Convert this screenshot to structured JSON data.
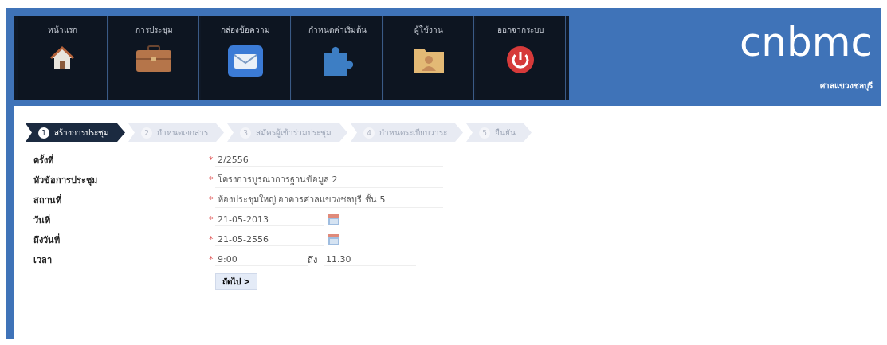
{
  "menu": [
    {
      "label": "หน้าแรก",
      "kind": "home"
    },
    {
      "label": "การประชุม",
      "kind": "briefcase"
    },
    {
      "label": "กล่องข้อความ",
      "kind": "mail"
    },
    {
      "label": "กำหนดค่าเริ่มต้น",
      "kind": "puzzle"
    },
    {
      "label": "ผู้ใช้งาน",
      "kind": "folder"
    },
    {
      "label": "ออกจากระบบ",
      "kind": "power"
    }
  ],
  "brand": {
    "logo": "cnbmc",
    "subtitle": "ศาลแขวงชลบุรี"
  },
  "steps": [
    {
      "number": "1",
      "label": "สร้างการประชุม",
      "selected": true
    },
    {
      "number": "2",
      "label": "กำหนดเอกสาร",
      "selected": false
    },
    {
      "number": "3",
      "label": "สมัครผู้เข้าร่วมประชุม",
      "selected": false
    },
    {
      "number": "4",
      "label": "กำหนดระเบียบวาระ",
      "selected": false
    },
    {
      "number": "5",
      "label": "ยืนยัน",
      "selected": false
    }
  ],
  "fields": [
    {
      "kind": "text",
      "label": "ครั้งที่",
      "mark": "*",
      "value": "2/2556"
    },
    {
      "kind": "text",
      "label": "หัวข้อการประชุม",
      "mark": "*",
      "value": "โครงการบูรณาการฐานข้อมูล 2"
    },
    {
      "kind": "text",
      "label": "สถานที่",
      "mark": "*",
      "value": "ห้องประชุมใหญ่  อาคารศาลแขวงชลบุรี ชั้น 5"
    },
    {
      "kind": "date",
      "label": "วันที่",
      "mark": "*",
      "value": "21-05-2013"
    },
    {
      "kind": "date",
      "label": "ถึงวันที่",
      "mark": "*",
      "value": "21-05-2556"
    },
    {
      "kind": "time",
      "label": "เวลา",
      "mark": "*",
      "value": "9:00",
      "to_label": "ถึง",
      "to_value": "11.30"
    }
  ],
  "next_button": "ถัดไป >"
}
